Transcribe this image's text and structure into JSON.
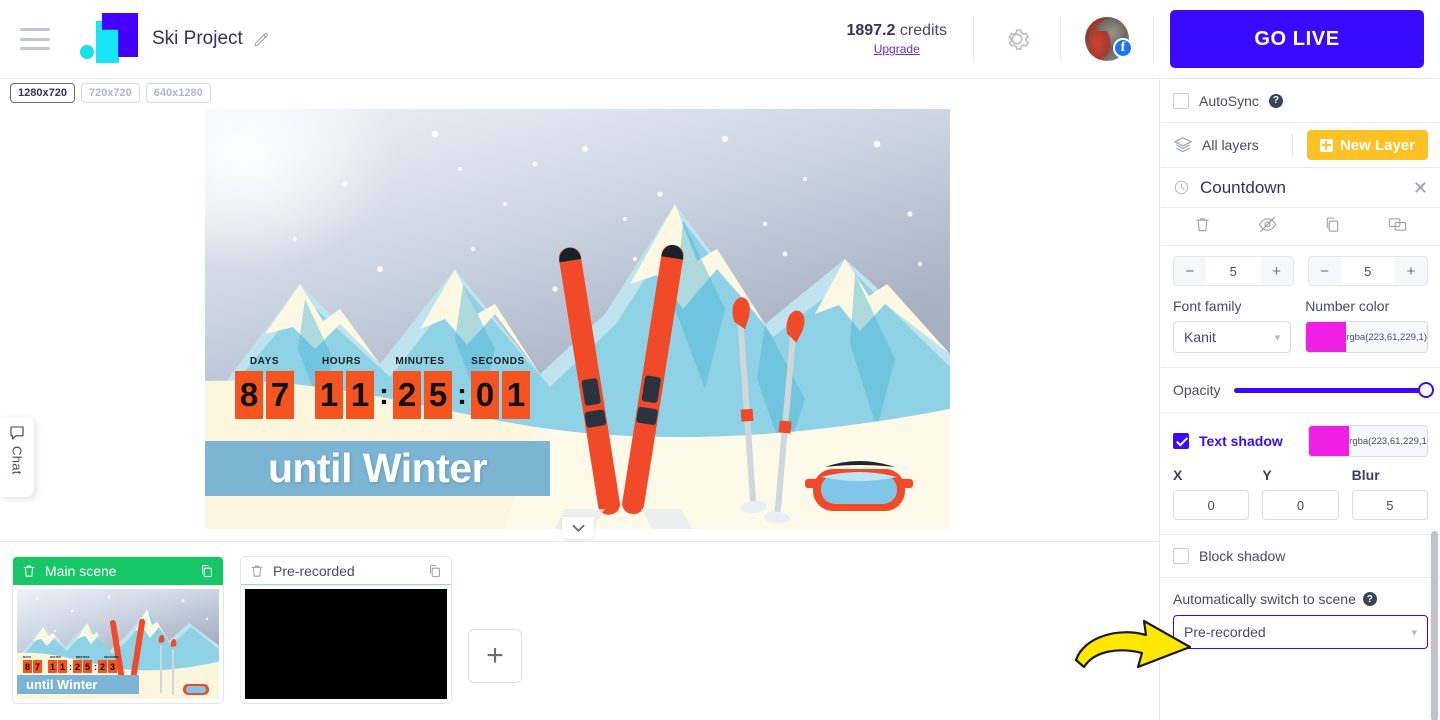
{
  "header": {
    "menu_icon": "hamburger-icon",
    "logo": "app-logo",
    "project_title": "Ski Project",
    "edit_icon": "pencil-icon",
    "credits_amount": "1897.2",
    "credits_label": "credits",
    "upgrade_label": "Upgrade",
    "settings_icon": "gear-icon",
    "avatar": "user-avatar",
    "social_badge": "f",
    "go_live_label": "GO LIVE"
  },
  "workspace": {
    "resolutions": [
      {
        "label": "1280x720",
        "active": true
      },
      {
        "label": "720x720",
        "active": false
      },
      {
        "label": "640x1280",
        "active": false
      }
    ],
    "chat_rail": {
      "icon": "chat-icon",
      "label": "Chat"
    },
    "collapse_icon": "chevron-down-icon"
  },
  "canvas": {
    "countdown": {
      "units": [
        {
          "label": "DAYS",
          "digits": [
            "8",
            "7"
          ]
        },
        {
          "label": "HOURS",
          "digits": [
            "1",
            "1"
          ]
        },
        {
          "label": "MINUTES",
          "digits": [
            "2",
            "5"
          ]
        },
        {
          "label": "SECONDS",
          "digits": [
            "0",
            "1"
          ]
        }
      ],
      "separator": ":",
      "digit_bg": "#f4541f"
    },
    "caption": "until Winter",
    "caption_bg": "#7cb4d4"
  },
  "scenes": {
    "items": [
      {
        "name": "Main scene",
        "active": true,
        "thumb": "ski-countdown-thumb"
      },
      {
        "name": "Pre-recorded",
        "active": false,
        "thumb": "black-thumb"
      }
    ],
    "thumb_countdown": {
      "labels": [
        "DAYS",
        "HOURS",
        "MINUTES",
        "SECONDS"
      ],
      "digits": [
        [
          "8",
          "7"
        ],
        [
          "1",
          "1"
        ],
        [
          "2",
          "5"
        ],
        [
          "2",
          "3"
        ]
      ],
      "caption": "until Winter"
    },
    "delete_icon": "trash-icon",
    "duplicate_icon": "copy-icon",
    "add_label": "+"
  },
  "panel": {
    "autosync_label": "AutoSync",
    "autosync_checked": false,
    "all_layers_label": "All layers",
    "layers_icon": "layers-icon",
    "new_layer_label": "New Layer",
    "new_layer_color": "#ffc225",
    "layer": {
      "icon": "clock-icon",
      "title": "Countdown",
      "close_icon": "close-icon",
      "tools": [
        "trash-icon",
        "eye-off-icon",
        "copy-icon",
        "send-to-scene-icon"
      ],
      "stepper_left_value": "5",
      "stepper_right_value": "5",
      "stepper_minus": "−",
      "stepper_plus": "+"
    },
    "font_family_label": "Font family",
    "font_family_value": "Kanit",
    "number_color_label": "Number color",
    "number_color_value": "rgba(223,61,229,1)",
    "number_color_hex": "#f01fe5",
    "opacity_label": "Opacity",
    "opacity_value": 100,
    "text_shadow_label": "Text shadow",
    "text_shadow_checked": true,
    "text_shadow_color_value": "rgba(223,61,229,1",
    "text_shadow_color_hex": "#f01fe5",
    "shadow_x_label": "X",
    "shadow_x_value": "0",
    "shadow_y_label": "Y",
    "shadow_y_value": "0",
    "shadow_blur_label": "Blur",
    "shadow_blur_value": "5",
    "block_shadow_label": "Block shadow",
    "block_shadow_checked": false,
    "auto_switch_label": "Automatically switch to scene",
    "auto_switch_value": "Pre-recorded",
    "accent_color": "#3a0aff"
  }
}
